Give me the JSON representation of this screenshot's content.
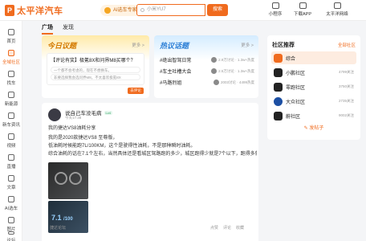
{
  "header": {
    "logo_mark": "P",
    "logo_text": "太平洋汽车",
    "brand_pill": "AI选车专家",
    "search_placeholder": "小米YU7",
    "search_button": "搜索",
    "links": [
      "小程序",
      "下载APP",
      "太平洋网络"
    ]
  },
  "sidebar": {
    "items": [
      {
        "label": "首页",
        "icon": "home-icon"
      },
      {
        "label": "全域社区",
        "icon": "community-icon"
      },
      {
        "label": "找车",
        "icon": "car-icon"
      },
      {
        "label": "新能源",
        "icon": "energy-icon"
      },
      {
        "label": "新车资讯",
        "icon": "news-icon"
      },
      {
        "label": "视频",
        "icon": "video-icon"
      },
      {
        "label": "直播",
        "icon": "live-icon"
      },
      {
        "label": "文章",
        "icon": "article-icon"
      },
      {
        "label": "AI选车",
        "icon": "ai-icon"
      },
      {
        "label": "图片",
        "icon": "image-icon"
      },
      {
        "label": "论坛",
        "icon": "forum-icon"
      }
    ],
    "active_index": 1
  },
  "tabs": [
    "广场",
    "发现"
  ],
  "today_topic": {
    "title": "今日议题",
    "more": "更多 >",
    "question": "【评论有奖】极氪8X和问界M8买哪个？",
    "options": [
      "一个都不会考虑的，现在不想换车。",
      "非要选择我会选问界M8，不太喜欢极氪8X"
    ],
    "button": "去评论"
  },
  "hot_topics": {
    "title": "热议话题",
    "more": "更多 >",
    "items": [
      {
        "name": "#绝出智驾日常",
        "meta": "2.9万讨论 · 1.3w+热度"
      },
      {
        "name": "#车主吐槽大会",
        "meta": "2.5万讨论 · 1.3w+热度"
      },
      {
        "name": "#马路烈姐",
        "meta": "2003讨论 · 4499热度"
      }
    ]
  },
  "community": {
    "title": "社区推荐",
    "all": "全部社区",
    "items": [
      {
        "name": "综合",
        "count": "",
        "color": "#f06b1e"
      },
      {
        "name": "小鹏社区",
        "count": "4799关注",
        "color": "#222222"
      },
      {
        "name": "零跑社区",
        "count": "3750关注",
        "color": "#222222"
      },
      {
        "name": "大众社区",
        "count": "2735关注",
        "color": "#1c4fa3"
      },
      {
        "name": "蔚社区",
        "count": "9002关注",
        "color": "#222222"
      }
    ],
    "post_button": "发帖子"
  },
  "post": {
    "author": "说自己车没毛病",
    "level": "Lv4",
    "date": "今天17:38",
    "lines": [
      "我的捷达VS8油耗分享",
      "我的是2020款捷达VS8 至尊版，",
      "低油耗时候能跑7L/100KM，这个是驶得性油耗，不是那种瞬时油耗。",
      "综合油耗的话在7.1个左右，当然具体还是看城区驾路跑的多少，城区跑得少就是7个以下，跑得多就7..."
    ],
    "image_value": "7.1",
    "image_unit": "/100",
    "forum": "捷达论坛",
    "actions": [
      "点赞",
      "评论",
      "收藏"
    ]
  }
}
